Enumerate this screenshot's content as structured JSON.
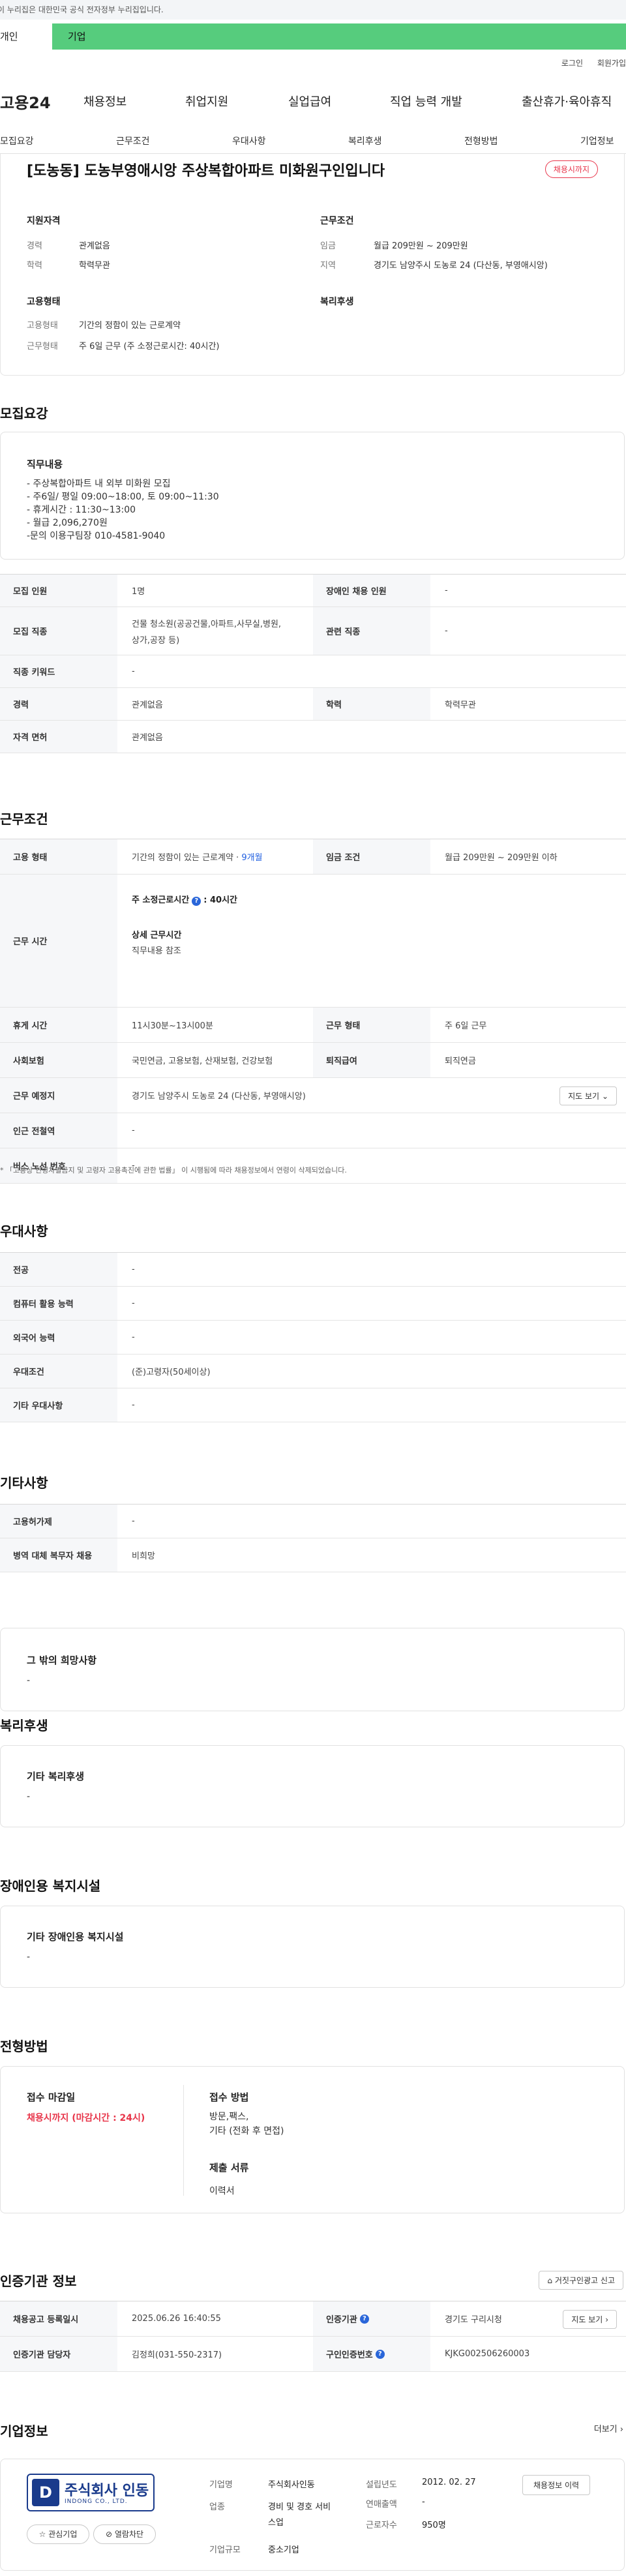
{
  "gov_notice": "이 누리집은 대한민국 공식 전자정부 누리집입니다.",
  "user_tabs": {
    "personal": "개인",
    "company": "기업"
  },
  "util": {
    "login": "로그인",
    "join": "회원가입"
  },
  "logo": "고용24",
  "gnb": [
    "채용정보",
    "취업지원",
    "실업급여",
    "직업 능력 개발",
    "출산휴가·육아휴직"
  ],
  "section_tabs": [
    "모집요강",
    "근무조건",
    "우대사항",
    "복리후생",
    "전형방법",
    "기업정보"
  ],
  "job": {
    "title": "[도농동] 도농부영애시앙 주상복합아파트 미화원구인입니다",
    "badge": "채용시까지",
    "qualification_title": "지원자격",
    "career_label": "경력",
    "career": "관계없음",
    "education_label": "학력",
    "education": "학력무관",
    "employment_title": "고용형태",
    "employment_label": "고용형태",
    "employment": "기간의 정함이 있는 근로계약",
    "workform_label": "근무형태",
    "workform": "주 6일 근무 (주 소정근로시간: 40시간)",
    "condition_title": "근무조건",
    "wage_label": "임금",
    "wage": "월급 209만원 ~ 209만원",
    "location_label": "지역",
    "location": "경기도 남양주시 도농로 24 (다산동, 부영애시앙)",
    "welfare_title": "복리후생"
  },
  "recruit": {
    "title": "모집요강",
    "duty_title": "직무내용",
    "duty_lines": [
      "- 주상복합아파트 내 외부 미화원 모집",
      "- 주6일/ 평일 09:00~18:00, 토 09:00~11:30",
      "- 휴게시간 : 11:30~13:00",
      "- 월급 2,096,270원",
      "-문의 이용구팀장 010-4581-9040"
    ],
    "rows": {
      "headcount_label": "모집 인원",
      "headcount": "1명",
      "disabled_label": "장애인 채용 인원",
      "disabled": "-",
      "job_type_label": "모집 직종",
      "job_type_1": "건물 청소원(공공건물,아파트,사무실,병원,",
      "job_type_2": "상가,공장 등)",
      "related_label": "관련 직종",
      "related": "-",
      "keyword_label": "직종 키워드",
      "keyword": "-",
      "career_label": "경력",
      "career": "관계없음",
      "edu_label": "학력",
      "edu": "학력무관",
      "license_label": "자격 면허",
      "license": "관계없음"
    }
  },
  "workcond": {
    "title": "근무조건",
    "emp_label": "고용 형태",
    "emp": "기간의 정함이 있는 근로계약 · ",
    "emp_period": "9개월",
    "wage_label": "임금 조건",
    "wage": "월급 209만원 ~ 209만원 이하",
    "hours_label": "근무 시간",
    "hours_main_key": "주 소정근로시간",
    "hours_main_val": ": 40시간",
    "hours_detail_key": "상세 근무시간",
    "hours_detail_val": "직무내용 참조",
    "rest_label": "휴게 시간",
    "rest": "11시30분~13시00분",
    "form_label": "근무 형태",
    "form": "주 6일 근무",
    "insurance_label": "사회보험",
    "insurance": "국민연금, 고용보험, 산재보험, 건강보험",
    "severance_label": "퇴직급여",
    "severance": "퇴직연금",
    "place_label": "근무 예정지",
    "place": "경기도 남양주시 도농로 24 (다산동, 부영애시앙)",
    "map_button": "지도 보기",
    "subway_label": "인근 전철역",
    "subway": "-",
    "bus_label": "버스 노선 번호",
    "bus": "-",
    "note": "* 「고용상 연령차별금지 및 고령자 고용촉진에 관한 법률」 이 시행됨에 따라 채용정보에서 연령이 삭제되었습니다."
  },
  "preference": {
    "title": "우대사항",
    "major_label": "전공",
    "major": "-",
    "computer_label": "컴퓨터 활용 능력",
    "computer": "-",
    "language_label": "외국어 능력",
    "language": "-",
    "cond_label": "우대조건",
    "cond": "(준)고령자(50세이상)",
    "etc_label": "기타 우대사항",
    "etc": "-"
  },
  "other": {
    "title": "기타사항",
    "employ_label": "고용허가제",
    "employ": "-",
    "military_label": "병역 대체 복무자 채용",
    "military": "비희망",
    "wish_title": "그 밖의 희망사항",
    "wish": "-"
  },
  "welfare": {
    "title": "복리후생",
    "box_title": "기타 복리후생",
    "value": "-"
  },
  "facility": {
    "title": "장애인용 복지시설",
    "box_title": "기타 장애인용 복지시설",
    "value": "-"
  },
  "selection": {
    "title": "전형방법",
    "deadline_title": "접수 마감일",
    "deadline": "채용시까지 (마감시간 : 24시)",
    "method_title": "접수 방법",
    "method_1": "방문,팩스,",
    "method_2": "기타 (전화 후 면접)",
    "docs_title": "제출 서류",
    "docs": "이력서"
  },
  "agency": {
    "title": "인증기관 정보",
    "report_button": "거짓구인광고 신고",
    "reg_label": "채용공고 등록일시",
    "reg": "2025.06.26 16:40:55",
    "org_label": "인증기관",
    "org": "경기도 구리시청",
    "manager_label": "인증기관 담당자",
    "manager": "김정희(031-550-2317)",
    "num_label": "구인인증번호",
    "num": "KJKG002506260003",
    "map_button": "지도 보기"
  },
  "company": {
    "title": "기업정보",
    "more": "더보기",
    "logo_mark": "D",
    "logo_name": "주식회사 인동",
    "logo_en": "INDONG CO., LTD.",
    "fav_button": "관심기업",
    "block_button": "열람차단",
    "history_button": "채용정보 이력",
    "name_label": "기업명",
    "name": "주식회사인동",
    "industry_label": "업종",
    "industry_1": "경비 및 경호 서비",
    "industry_2": "스업",
    "size_label": "기업규모",
    "size": "중소기업",
    "founded_label": "설립년도",
    "founded": "2012. 02. 27",
    "sales_label": "연매출액",
    "sales": "-",
    "workers_label": "근로자수",
    "workers": "950명"
  }
}
